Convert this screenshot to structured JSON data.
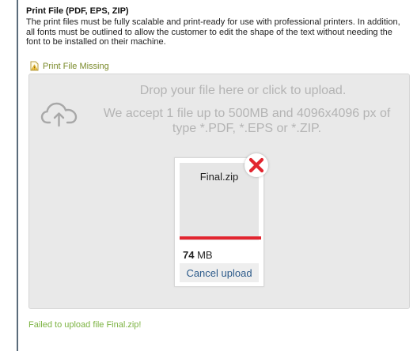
{
  "section": {
    "title": "Print File (PDF, EPS, ZIP)",
    "description": "The print files must be fully scalable and print-ready for use with professional printers. In addition, all fonts must be outlined to allow the customer to edit the shape of the text without needing the font to be installed on their machine."
  },
  "status": {
    "missing_label": "Print File Missing",
    "warning_icon": "warning-file-icon"
  },
  "dropzone": {
    "line1": "Drop your file here or click to upload.",
    "line2": "We accept 1 file up to 500MB and 4096x4096 px of type *.PDF, *.EPS or *.ZIP.",
    "upload_icon": "cloud-upload-icon"
  },
  "file": {
    "name": "Final.zip",
    "size_value": "74",
    "size_unit": "MB",
    "progress_fraction": 1.0,
    "progress_color": "#e2252f",
    "cancel_label": "Cancel upload",
    "remove_icon": "close-icon"
  },
  "error": {
    "message": "Failed to upload file Final.zip!",
    "color": "#7cb342"
  }
}
